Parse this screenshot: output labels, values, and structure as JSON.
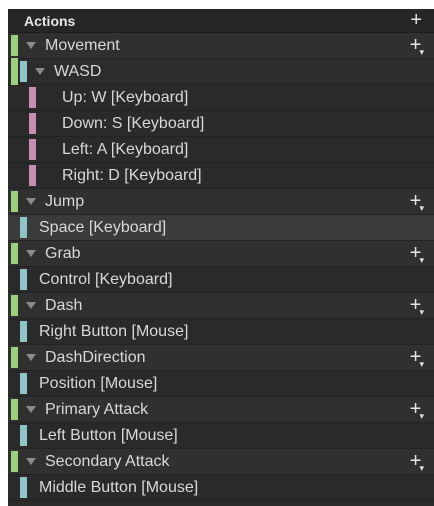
{
  "panel": {
    "title": "Actions",
    "add_glyph": "+",
    "colors": {
      "action_bar": "#9ccf7e",
      "binding_bar": "#8fc4c9",
      "composite_part_bar": "#c98fb0"
    }
  },
  "rows": [
    {
      "kind": "action",
      "label": "Movement",
      "add": true
    },
    {
      "kind": "composite",
      "label": "WASD"
    },
    {
      "kind": "part",
      "label": "Up: W [Keyboard]"
    },
    {
      "kind": "part",
      "label": "Down: S [Keyboard]"
    },
    {
      "kind": "part",
      "label": "Left: A [Keyboard]"
    },
    {
      "kind": "part",
      "label": "Right: D [Keyboard]"
    },
    {
      "kind": "action",
      "label": "Jump",
      "add": true
    },
    {
      "kind": "binding",
      "label": "Space [Keyboard]",
      "selected": true
    },
    {
      "kind": "action",
      "label": "Grab",
      "add": true
    },
    {
      "kind": "binding",
      "label": "Control [Keyboard]"
    },
    {
      "kind": "action",
      "label": "Dash",
      "add": true
    },
    {
      "kind": "binding",
      "label": "Right Button [Mouse]"
    },
    {
      "kind": "action",
      "label": "DashDirection",
      "add": true
    },
    {
      "kind": "binding",
      "label": "Position [Mouse]"
    },
    {
      "kind": "action",
      "label": "Primary Attack",
      "add": true
    },
    {
      "kind": "binding",
      "label": "Left Button [Mouse]"
    },
    {
      "kind": "action",
      "label": "Secondary Attack",
      "add": true
    },
    {
      "kind": "binding",
      "label": "Middle Button [Mouse]"
    }
  ]
}
